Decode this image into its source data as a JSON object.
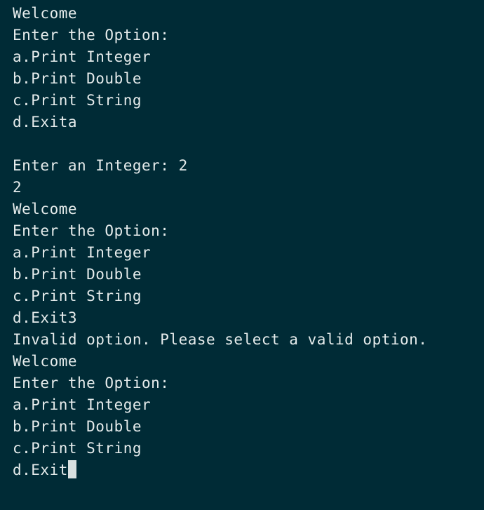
{
  "terminal": {
    "lines": [
      "Welcome",
      "Enter the Option:",
      "a.Print Integer",
      "b.Print Double",
      "c.Print String",
      "d.Exita",
      "",
      "Enter an Integer: 2",
      "2",
      "Welcome",
      "Enter the Option:",
      "a.Print Integer",
      "b.Print Double",
      "c.Print String",
      "d.Exit3",
      "Invalid option. Please select a valid option.",
      "Welcome",
      "Enter the Option:",
      "a.Print Integer",
      "b.Print Double",
      "c.Print String",
      "d.Exit"
    ],
    "colors": {
      "background": "#002b36",
      "text": "#e6ecec",
      "cursor": "#d9e0e0"
    }
  }
}
